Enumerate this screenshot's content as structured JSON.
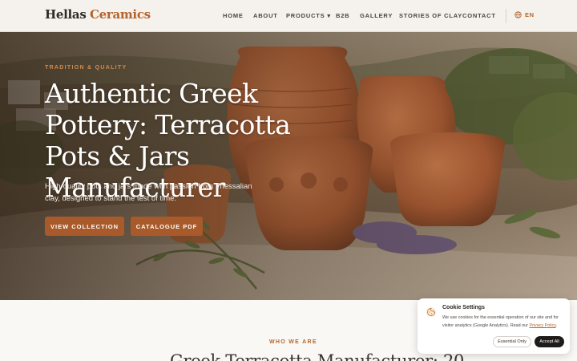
{
  "brand": {
    "part1": "Hellas",
    "part2": "Ceramics"
  },
  "nav": {
    "items": [
      "HOME",
      "ABOUT",
      "PRODUCTS ▾",
      "B2B",
      "GALLERY",
      "STORIES OF CLAY",
      "CONTACT"
    ],
    "language": "EN"
  },
  "hero": {
    "eyebrow": "TRADITION & QUALITY",
    "title": "Authentic Greek Pottery: Terracotta Pots & Jars Manufacturer",
    "subtitle": "High-quality pots and jars made with passion from Thessalian clay, designed to stand the test of time.",
    "primary_button": "VIEW COLLECTION",
    "secondary_button": "CATALOGUE PDF"
  },
  "about": {
    "eyebrow": "WHO WE ARE",
    "title": "Greek Terracotta Manufacturer: 20"
  },
  "cookie": {
    "title": "Cookie Settings",
    "text": "We use cookies for the essential operation of our site and for visitor analytics (Google Analytics). Read our",
    "link": "Privacy Policy",
    "text_end": ".",
    "essential_button": "Essential Only",
    "accept_button": "Accept All"
  },
  "colors": {
    "accent": "#b5632c",
    "button": "#a85a2a",
    "dark": "#1e1b19"
  }
}
